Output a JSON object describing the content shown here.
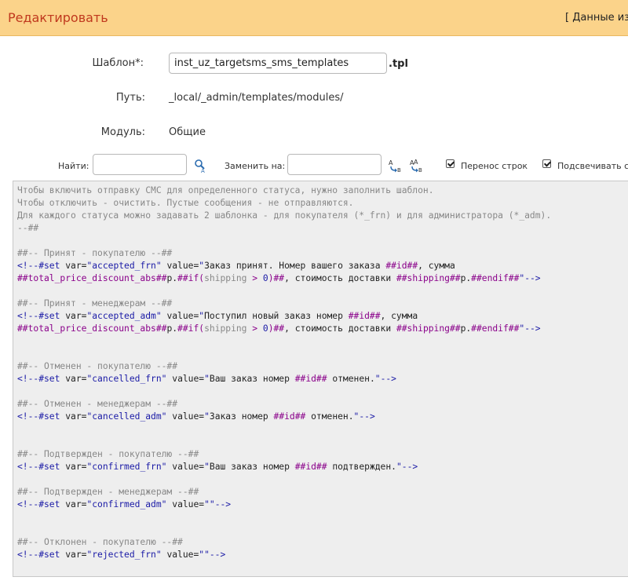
{
  "header": {
    "title": "Редактировать",
    "link": "[ Данные из"
  },
  "form": {
    "template_label": "Шаблон*:",
    "template_value": "inst_uz_targetsms_sms_templates",
    "template_ext": ".tpl",
    "path_label": "Путь:",
    "path_value": "_local/_admin/templates/modules/",
    "module_label": "Модуль:",
    "module_value": "Общие"
  },
  "toolbar": {
    "find_label": "Найти:",
    "find_value": "",
    "replace_label": "Заменить на:",
    "replace_value": "",
    "wrap_label": "Перенос строк",
    "wrap_checked": true,
    "highlight_label": "Подсвечивать с",
    "highlight_checked": true
  },
  "editor": {
    "lines": [
      [
        [
          "c",
          "Чтобы включить отправку СМС для определенного статуса, нужно заполнить шаблон."
        ]
      ],
      [
        [
          "c",
          "Чтобы отключить - очистить. Пустые сообщения - не отправляются."
        ]
      ],
      [
        [
          "c",
          "Для каждого статуса можно задавать 2 шаблонка - для покупателя (*_frn) и для администратора (*_adm)."
        ]
      ],
      [
        [
          "c",
          "--##"
        ]
      ],
      [],
      [
        [
          "c",
          "##-- Принят - покупателю --##"
        ]
      ],
      [
        [
          "g",
          "<!--#set "
        ],
        [
          "a",
          "var="
        ],
        [
          "s",
          "\"accepted_frn\""
        ],
        [
          "a",
          " value="
        ],
        [
          "s",
          "\""
        ],
        [
          "x",
          "Заказ принят. Номер вашего заказа "
        ],
        [
          "v",
          "##id##"
        ],
        [
          "x",
          ", сумма"
        ]
      ],
      [
        [
          "v",
          "##total_price_discount_abs##"
        ],
        [
          "x",
          "р."
        ],
        [
          "v",
          "##if("
        ],
        [
          "c",
          "shipping"
        ],
        [
          "v",
          " > "
        ],
        [
          "n",
          "0"
        ],
        [
          "v",
          ")##"
        ],
        [
          "x",
          ", стоимость доставки "
        ],
        [
          "v",
          "##shipping##"
        ],
        [
          "x",
          "р."
        ],
        [
          "v",
          "##endif##"
        ],
        [
          "s",
          "\""
        ],
        [
          "g",
          "-->"
        ]
      ],
      [],
      [
        [
          "c",
          "##-- Принят - менеджерам --##"
        ]
      ],
      [
        [
          "g",
          "<!--#set "
        ],
        [
          "a",
          "var="
        ],
        [
          "s",
          "\"accepted_adm\""
        ],
        [
          "a",
          " value="
        ],
        [
          "s",
          "\""
        ],
        [
          "x",
          "Поступил новый заказ номер "
        ],
        [
          "v",
          "##id##"
        ],
        [
          "x",
          ", сумма"
        ]
      ],
      [
        [
          "v",
          "##total_price_discount_abs##"
        ],
        [
          "x",
          "р."
        ],
        [
          "v",
          "##if("
        ],
        [
          "c",
          "shipping"
        ],
        [
          "v",
          " > "
        ],
        [
          "n",
          "0"
        ],
        [
          "v",
          ")##"
        ],
        [
          "x",
          ", стоимость доставки "
        ],
        [
          "v",
          "##shipping##"
        ],
        [
          "x",
          "р."
        ],
        [
          "v",
          "##endif##"
        ],
        [
          "s",
          "\""
        ],
        [
          "g",
          "-->"
        ]
      ],
      [],
      [],
      [
        [
          "c",
          "##-- Отменен - покупателю --##"
        ]
      ],
      [
        [
          "g",
          "<!--#set "
        ],
        [
          "a",
          "var="
        ],
        [
          "s",
          "\"cancelled_frn\""
        ],
        [
          "a",
          " value="
        ],
        [
          "s",
          "\""
        ],
        [
          "x",
          "Ваш заказ номер "
        ],
        [
          "v",
          "##id##"
        ],
        [
          "x",
          " отменен."
        ],
        [
          "s",
          "\""
        ],
        [
          "g",
          "-->"
        ]
      ],
      [],
      [
        [
          "c",
          "##-- Отменен - менеджерам --##"
        ]
      ],
      [
        [
          "g",
          "<!--#set "
        ],
        [
          "a",
          "var="
        ],
        [
          "s",
          "\"cancelled_adm\""
        ],
        [
          "a",
          " value="
        ],
        [
          "s",
          "\""
        ],
        [
          "x",
          "Заказ номер "
        ],
        [
          "v",
          "##id##"
        ],
        [
          "x",
          " отменен."
        ],
        [
          "s",
          "\""
        ],
        [
          "g",
          "-->"
        ]
      ],
      [],
      [],
      [
        [
          "c",
          "##-- Подтвержден - покупателю --##"
        ]
      ],
      [
        [
          "g",
          "<!--#set "
        ],
        [
          "a",
          "var="
        ],
        [
          "s",
          "\"confirmed_frn\""
        ],
        [
          "a",
          " value="
        ],
        [
          "s",
          "\""
        ],
        [
          "x",
          "Ваш заказ номер "
        ],
        [
          "v",
          "##id##"
        ],
        [
          "x",
          " подтвержден."
        ],
        [
          "s",
          "\""
        ],
        [
          "g",
          "-->"
        ]
      ],
      [],
      [
        [
          "c",
          "##-- Подтвержден - менеджерам --##"
        ]
      ],
      [
        [
          "g",
          "<!--#set "
        ],
        [
          "a",
          "var="
        ],
        [
          "s",
          "\"confirmed_adm\""
        ],
        [
          "a",
          " value="
        ],
        [
          "s",
          "\"\""
        ],
        [
          "g",
          "-->"
        ]
      ],
      [],
      [],
      [
        [
          "c",
          "##-- Отклонен - покупателю --##"
        ]
      ],
      [
        [
          "g",
          "<!--#set "
        ],
        [
          "a",
          "var="
        ],
        [
          "s",
          "\"rejected_frn\""
        ],
        [
          "a",
          " value="
        ],
        [
          "s",
          "\"\""
        ],
        [
          "g",
          "-->"
        ]
      ]
    ]
  }
}
